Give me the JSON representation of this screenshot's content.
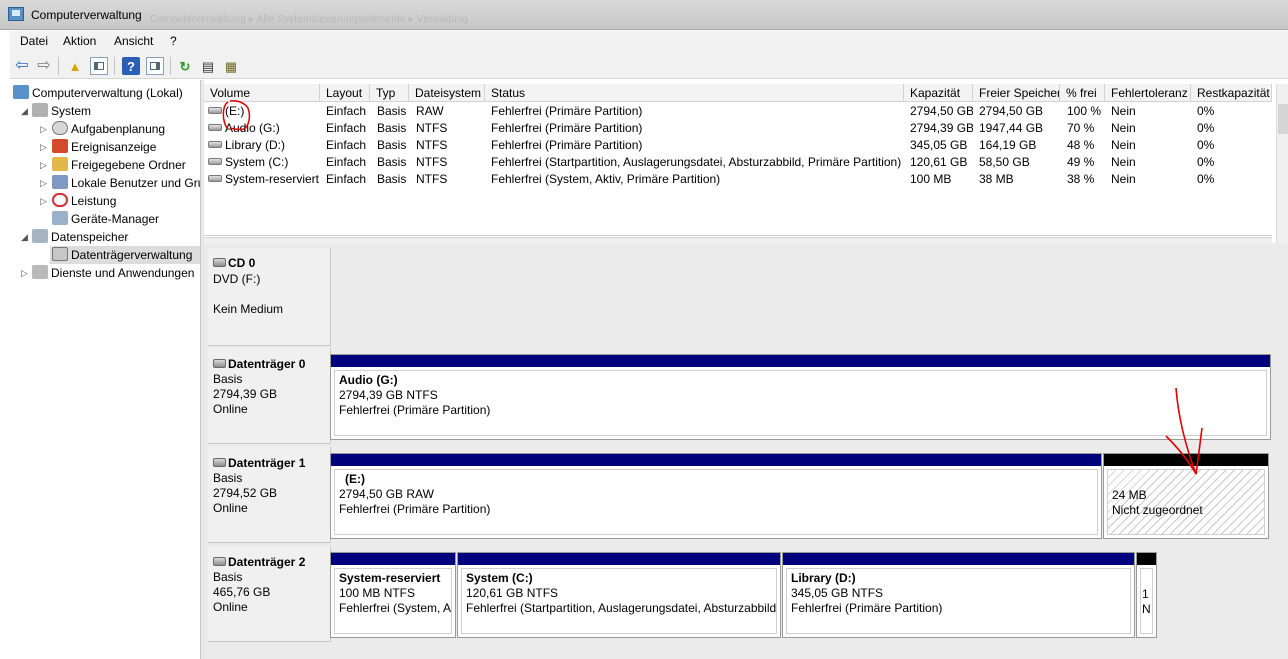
{
  "window": {
    "title": "Computerverwaltung",
    "title_ghost": "Computerverwaltung  ▸  Alle Systemsteuerungselemente  ▸  Verwaltung"
  },
  "menu": [
    "Datei",
    "Aktion",
    "Ansicht",
    "?"
  ],
  "toolbar_icons": [
    "back-arrow-icon",
    "forward-arrow-icon",
    "up-folder-icon",
    "show-hide-tree-icon",
    "help-icon",
    "show-hide-action-pane-icon",
    "refresh-icon",
    "properties-icon",
    "export-icon"
  ],
  "tree": {
    "root": "Computerverwaltung (Lokal)",
    "system": "System",
    "system_children": [
      "Aufgabenplanung",
      "Ereignisanzeige",
      "Freigegebene Ordner",
      "Lokale Benutzer und Gruppen",
      "Leistung",
      "Geräte-Manager"
    ],
    "storage": "Datenspeicher",
    "storage_children": [
      "Datenträgerverwaltung"
    ],
    "services": "Dienste und Anwendungen"
  },
  "volume_columns": [
    "Volume",
    "Layout",
    "Typ",
    "Dateisystem",
    "Status",
    "Kapazität",
    "Freier Speicher",
    "% frei",
    "Fehlertoleranz",
    "Restkapazität"
  ],
  "volumes": [
    [
      "(E:)",
      "Einfach",
      "Basis",
      "RAW",
      "Fehlerfrei (Primäre Partition)",
      "2794,50 GB",
      "2794,50 GB",
      "100 %",
      "Nein",
      "0%"
    ],
    [
      "Audio (G:)",
      "Einfach",
      "Basis",
      "NTFS",
      "Fehlerfrei (Primäre Partition)",
      "2794,39 GB",
      "1947,44 GB",
      "70 %",
      "Nein",
      "0%"
    ],
    [
      "Library (D:)",
      "Einfach",
      "Basis",
      "NTFS",
      "Fehlerfrei (Primäre Partition)",
      "345,05 GB",
      "164,19 GB",
      "48 %",
      "Nein",
      "0%"
    ],
    [
      "System (C:)",
      "Einfach",
      "Basis",
      "NTFS",
      "Fehlerfrei (Startpartition, Auslagerungsdatei, Absturzabbild, Primäre Partition)",
      "120,61 GB",
      "58,50 GB",
      "49 %",
      "Nein",
      "0%"
    ],
    [
      "System-reserviert",
      "Einfach",
      "Basis",
      "NTFS",
      "Fehlerfrei (System, Aktiv, Primäre Partition)",
      "100 MB",
      "38 MB",
      "38 %",
      "Nein",
      "0%"
    ]
  ],
  "disks": [
    {
      "name": "CD 0",
      "line1": "DVD (F:)",
      "line2": "",
      "line3": "Kein Medium",
      "partitions": []
    },
    {
      "name": "Datenträger 0",
      "line1": "Basis",
      "line2": "2794,39 GB",
      "line3": "Online",
      "partitions": [
        {
          "name": "Audio  (G:)",
          "size": "2794,39 GB NTFS",
          "status": "Fehlerfrei (Primäre Partition)"
        }
      ]
    },
    {
      "name": "Datenträger 1",
      "line1": "Basis",
      "line2": "2794,52 GB",
      "line3": "Online",
      "partitions": [
        {
          "name": "(E:)",
          "size": "2794,50 GB RAW",
          "status": "Fehlerfrei (Primäre Partition)"
        },
        {
          "name": "",
          "size": "24 MB",
          "status": "Nicht zugeordnet"
        }
      ]
    },
    {
      "name": "Datenträger 2",
      "line1": "Basis",
      "line2": "465,76 GB",
      "line3": "Online",
      "partitions": [
        {
          "name": "System-reserviert",
          "size": "100 MB NTFS",
          "status": "Fehlerfrei (System, Aktiv, Primäre Partition)"
        },
        {
          "name": "System  (C:)",
          "size": "120,61 GB NTFS",
          "status": "Fehlerfrei (Startpartition, Auslagerungsdatei, Absturzabbild, Primäre Partition)"
        },
        {
          "name": "Library  (D:)",
          "size": "345,05 GB NTFS",
          "status": "Fehlerfrei (Primäre Partition)"
        },
        {
          "name": "",
          "size": "1",
          "status": "N"
        }
      ]
    }
  ],
  "colors": {
    "partition_bar": "#00007d",
    "unallocated_bar": "#000000",
    "annotation": "#e00000"
  }
}
